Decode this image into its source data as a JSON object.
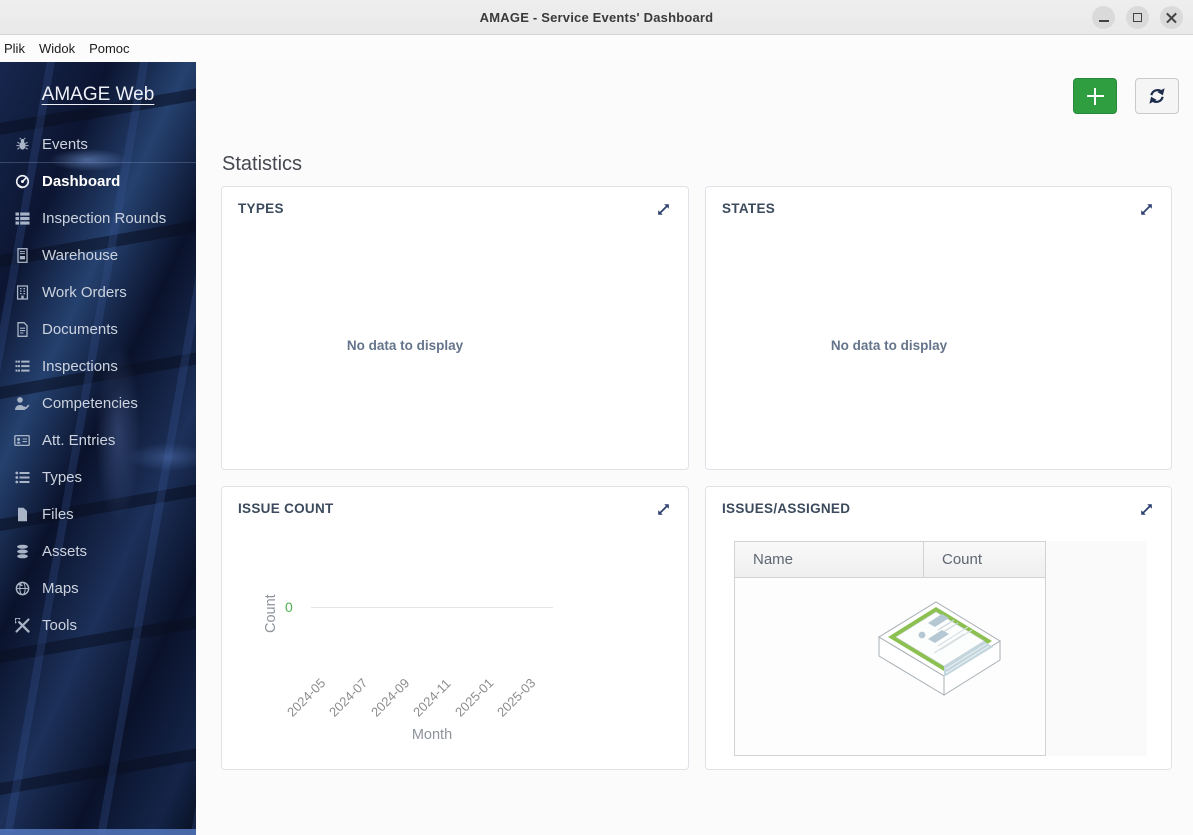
{
  "window": {
    "title": "AMAGE - Service Events' Dashboard",
    "controls": [
      "minimize",
      "maximize",
      "close"
    ]
  },
  "menubar": {
    "items": [
      "Plik",
      "Widok",
      "Pomoc"
    ]
  },
  "sidebar": {
    "logo": "AMAGE Web",
    "items": [
      {
        "label": "Events",
        "icon": "bug-icon",
        "active": false
      },
      {
        "label": "Dashboard",
        "icon": "gauge-icon",
        "active": true
      },
      {
        "label": "Inspection Rounds",
        "icon": "rows-icon",
        "active": false
      },
      {
        "label": "Warehouse",
        "icon": "invoice-icon",
        "active": false
      },
      {
        "label": "Work Orders",
        "icon": "building-icon",
        "active": false
      },
      {
        "label": "Documents",
        "icon": "document-icon",
        "active": false
      },
      {
        "label": "Inspections",
        "icon": "tasks-icon",
        "active": false
      },
      {
        "label": "Competencies",
        "icon": "user-check-icon",
        "active": false
      },
      {
        "label": "Att. Entries",
        "icon": "id-card-icon",
        "active": false
      },
      {
        "label": "Types",
        "icon": "list-icon",
        "active": false
      },
      {
        "label": "Files",
        "icon": "file-icon",
        "active": false
      },
      {
        "label": "Assets",
        "icon": "database-icon",
        "active": false
      },
      {
        "label": "Maps",
        "icon": "globe-icon",
        "active": false
      },
      {
        "label": "Tools",
        "icon": "tools-icon",
        "active": false
      }
    ]
  },
  "toolbar": {
    "add_icon": "plus-icon",
    "refresh_icon": "refresh-icon"
  },
  "main": {
    "heading": "Statistics",
    "cards": {
      "types": {
        "title": "TYPES",
        "empty_text": "No data to display"
      },
      "states": {
        "title": "STATES",
        "empty_text": "No data to display"
      },
      "issue_count": {
        "title": "ISSUE COUNT"
      },
      "issues_assigned": {
        "title": "ISSUES/ASSIGNED",
        "columns": [
          "Name",
          "Count"
        ],
        "rows": [],
        "empty_illustration": "empty-tray-illustration"
      }
    }
  },
  "chart_data": {
    "type": "line",
    "title": "ISSUE COUNT",
    "x": [
      "2024-05",
      "2024-07",
      "2024-09",
      "2024-11",
      "2025-01",
      "2025-03"
    ],
    "series": [],
    "xlabel": "Month",
    "ylabel": "Count",
    "yticks": [
      "0"
    ],
    "ylim": [
      0,
      0
    ],
    "grid": true,
    "legend": false,
    "note": "empty chart - no data points plotted"
  },
  "colors": {
    "add_button_green": "#2f9e41",
    "zero_tick_green": "#4caf50",
    "tray_green": "#8cc152",
    "expand_icon_navy": "#2e4170",
    "sidebar_base": "#0a1126"
  }
}
